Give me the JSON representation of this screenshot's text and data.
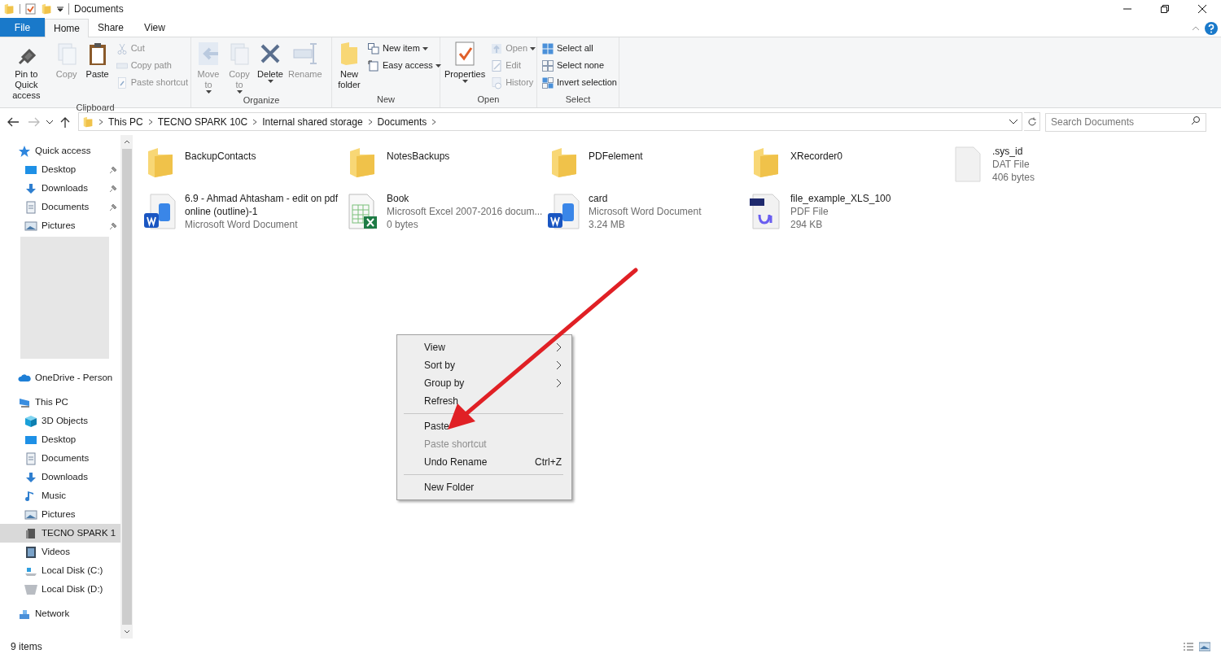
{
  "window": {
    "title": "Documents"
  },
  "ribbon_tabs": [
    {
      "label": "File",
      "kind": "file",
      "selected": false
    },
    {
      "label": "Home",
      "kind": "tab",
      "selected": true
    },
    {
      "label": "Share",
      "kind": "tab",
      "selected": false
    },
    {
      "label": "View",
      "kind": "tab",
      "selected": false
    }
  ],
  "ribbon_groups": [
    {
      "name": "Clipboard",
      "items": [
        {
          "label": "Pin to Quick\naccess",
          "kind": "large",
          "disabled": false,
          "caret": false
        },
        {
          "label": "Copy",
          "kind": "large",
          "disabled": true,
          "caret": false
        },
        {
          "label": "Paste",
          "kind": "large",
          "disabled": false,
          "caret": false
        },
        {
          "label": "Cut",
          "kind": "small",
          "disabled": true,
          "caret": false
        },
        {
          "label": "Copy path",
          "kind": "small",
          "disabled": true,
          "caret": false
        },
        {
          "label": "Paste shortcut",
          "kind": "small",
          "disabled": true,
          "caret": false
        }
      ]
    },
    {
      "name": "Organize",
      "items": [
        {
          "label": "Move\nto",
          "kind": "large",
          "disabled": true,
          "caret": true
        },
        {
          "label": "Copy\nto",
          "kind": "large",
          "disabled": true,
          "caret": true
        },
        {
          "label": "Delete",
          "kind": "large",
          "disabled": false,
          "caret": true
        },
        {
          "label": "Rename",
          "kind": "large",
          "disabled": true,
          "caret": false
        }
      ]
    },
    {
      "name": "New",
      "items": [
        {
          "label": "New\nfolder",
          "kind": "large",
          "disabled": false,
          "caret": false
        },
        {
          "label": "New item",
          "kind": "small",
          "disabled": false,
          "caret": true
        },
        {
          "label": "Easy access",
          "kind": "small",
          "disabled": false,
          "caret": true
        }
      ]
    },
    {
      "name": "Open",
      "items": [
        {
          "label": "Properties",
          "kind": "large",
          "disabled": false,
          "caret": true
        },
        {
          "label": "Open",
          "kind": "small",
          "disabled": true,
          "caret": true
        },
        {
          "label": "Edit",
          "kind": "small",
          "disabled": true,
          "caret": false
        },
        {
          "label": "History",
          "kind": "small",
          "disabled": true,
          "caret": false
        }
      ]
    },
    {
      "name": "Select",
      "items": [
        {
          "label": "Select all",
          "kind": "small",
          "disabled": false,
          "caret": false
        },
        {
          "label": "Select none",
          "kind": "small",
          "disabled": false,
          "caret": false
        },
        {
          "label": "Invert selection",
          "kind": "small",
          "disabled": false,
          "caret": false
        }
      ]
    }
  ],
  "address": {
    "breadcrumbs": [
      "This PC",
      "TECNO SPARK 10C",
      "Internal shared storage",
      "Documents"
    ]
  },
  "search": {
    "placeholder": "Search Documents"
  },
  "navigation": [
    {
      "label": "Quick access",
      "kind": "quick",
      "selected": false,
      "children": [
        {
          "label": "Desktop",
          "kind": "desktop",
          "pinned": true,
          "selected": false
        },
        {
          "label": "Downloads",
          "kind": "downloads",
          "pinned": true,
          "selected": false
        },
        {
          "label": "Documents",
          "kind": "documents",
          "pinned": true,
          "selected": false
        },
        {
          "label": "Pictures",
          "kind": "pictures",
          "pinned": true,
          "selected": false
        }
      ]
    },
    {
      "label": "OneDrive - Person",
      "kind": "cloud",
      "selected": false
    },
    {
      "label": "This PC",
      "kind": "pc",
      "selected": false,
      "children": [
        {
          "label": "3D Objects",
          "kind": "cube",
          "pinned": false,
          "selected": false
        },
        {
          "label": "Desktop",
          "kind": "desktop",
          "pinned": false,
          "selected": false
        },
        {
          "label": "Documents",
          "kind": "documents",
          "pinned": false,
          "selected": false
        },
        {
          "label": "Downloads",
          "kind": "downloads",
          "pinned": false,
          "selected": false
        },
        {
          "label": "Music",
          "kind": "music",
          "pinned": false,
          "selected": false
        },
        {
          "label": "Pictures",
          "kind": "pictures",
          "pinned": false,
          "selected": false
        },
        {
          "label": "TECNO SPARK 1",
          "kind": "phone",
          "pinned": false,
          "selected": true
        },
        {
          "label": "Videos",
          "kind": "videos",
          "pinned": false,
          "selected": false
        },
        {
          "label": "Local Disk (C:)",
          "kind": "disk_c",
          "pinned": false,
          "selected": false
        },
        {
          "label": "Local Disk (D:)",
          "kind": "disk",
          "pinned": false,
          "selected": false
        }
      ]
    },
    {
      "label": "Network",
      "kind": "network",
      "selected": false
    }
  ],
  "files": [
    {
      "name": "BackupContacts",
      "kind": "folder"
    },
    {
      "name": "NotesBackups",
      "kind": "folder"
    },
    {
      "name": "PDFelement",
      "kind": "folder"
    },
    {
      "name": "XRecorder0",
      "kind": "folder"
    },
    {
      "name": ".sys_id",
      "kind": "blank",
      "details": [
        "DAT File",
        "406 bytes"
      ]
    },
    {
      "name": "6.9 - Ahmad Ahtasham - edit on pdf online (outline)-1",
      "kind": "word",
      "details": [
        "Microsoft Word Document"
      ]
    },
    {
      "name": "Book",
      "kind": "excel",
      "details": [
        "Microsoft Excel 2007-2016 docum...",
        "0 bytes"
      ]
    },
    {
      "name": "card",
      "kind": "word",
      "details": [
        "Microsoft Word Document",
        "3.24 MB"
      ]
    },
    {
      "name": "file_example_XLS_100",
      "kind": "pdf",
      "details": [
        "PDF File",
        "294 KB"
      ]
    }
  ],
  "context_menu": [
    {
      "kind": "item",
      "label": "View",
      "submenu": true,
      "disabled": false
    },
    {
      "kind": "item",
      "label": "Sort by",
      "submenu": true,
      "disabled": false
    },
    {
      "kind": "item",
      "label": "Group by",
      "submenu": true,
      "disabled": false
    },
    {
      "kind": "item",
      "label": "Refresh",
      "submenu": false,
      "disabled": false
    },
    {
      "kind": "separator"
    },
    {
      "kind": "item",
      "label": "Paste",
      "submenu": false,
      "disabled": false
    },
    {
      "kind": "item",
      "label": "Paste shortcut",
      "submenu": false,
      "disabled": true
    },
    {
      "kind": "item",
      "label": "Undo Rename",
      "shortcut": "Ctrl+Z",
      "submenu": false,
      "disabled": false
    },
    {
      "kind": "separator"
    },
    {
      "kind": "item",
      "label": "New Folder",
      "submenu": false,
      "disabled": false
    }
  ],
  "status_bar": {
    "item_count": "9 items"
  }
}
